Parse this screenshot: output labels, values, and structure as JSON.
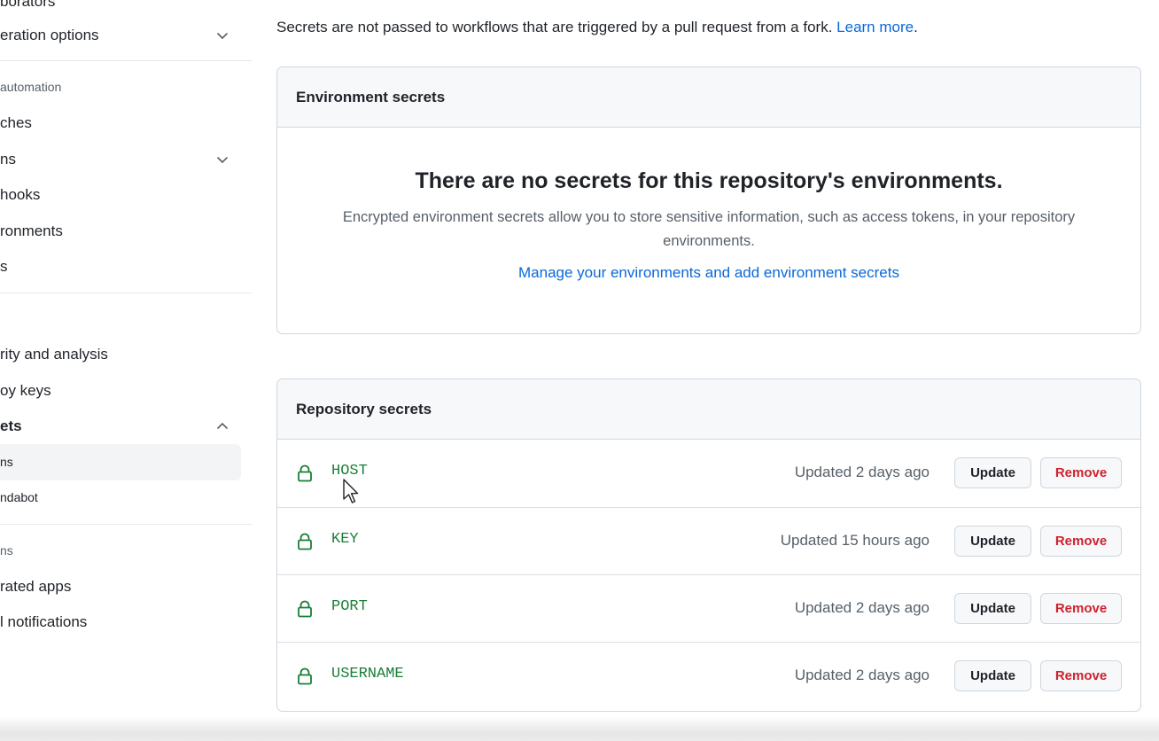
{
  "sidebar": {
    "items": [
      {
        "label": "borators"
      },
      {
        "label": "eration options"
      },
      {
        "label": "automation"
      },
      {
        "label": "ches"
      },
      {
        "label": "ns"
      },
      {
        "label": "hooks"
      },
      {
        "label": "ronments"
      },
      {
        "label": "s"
      },
      {
        "label": "rity and analysis"
      },
      {
        "label": "oy keys"
      },
      {
        "label": "ets"
      },
      {
        "label": "ns"
      },
      {
        "label": "ndabot"
      },
      {
        "label": "ns"
      },
      {
        "label": "rated apps"
      },
      {
        "label": "l notifications"
      }
    ]
  },
  "notice": {
    "text": "Secrets are not passed to workflows that are triggered by a pull request from a fork.",
    "link": "Learn more",
    "trailing": "."
  },
  "environment_secrets": {
    "header": "Environment secrets",
    "empty_title": "There are no secrets for this repository's environments.",
    "empty_description": "Encrypted environment secrets allow you to store sensitive information, such as access tokens, in your repository environments.",
    "manage_link": "Manage your environments and add environment secrets"
  },
  "repository_secrets": {
    "header": "Repository secrets",
    "rows": [
      {
        "name": "HOST",
        "updated": "Updated 2 days ago",
        "update_label": "Update",
        "remove_label": "Remove"
      },
      {
        "name": "KEY",
        "updated": "Updated 15 hours ago",
        "update_label": "Update",
        "remove_label": "Remove"
      },
      {
        "name": "PORT",
        "updated": "Updated 2 days ago",
        "update_label": "Update",
        "remove_label": "Remove"
      },
      {
        "name": "USERNAME",
        "updated": "Updated 2 days ago",
        "update_label": "Update",
        "remove_label": "Remove"
      }
    ]
  },
  "colors": {
    "link": "#0969da",
    "secret_name": "#1a7f37",
    "remove": "#cf222e",
    "border": "#d0d7de"
  },
  "icons": [
    "chevron-down-icon",
    "chevron-up-icon",
    "lock-icon",
    "mouse-cursor-icon"
  ]
}
